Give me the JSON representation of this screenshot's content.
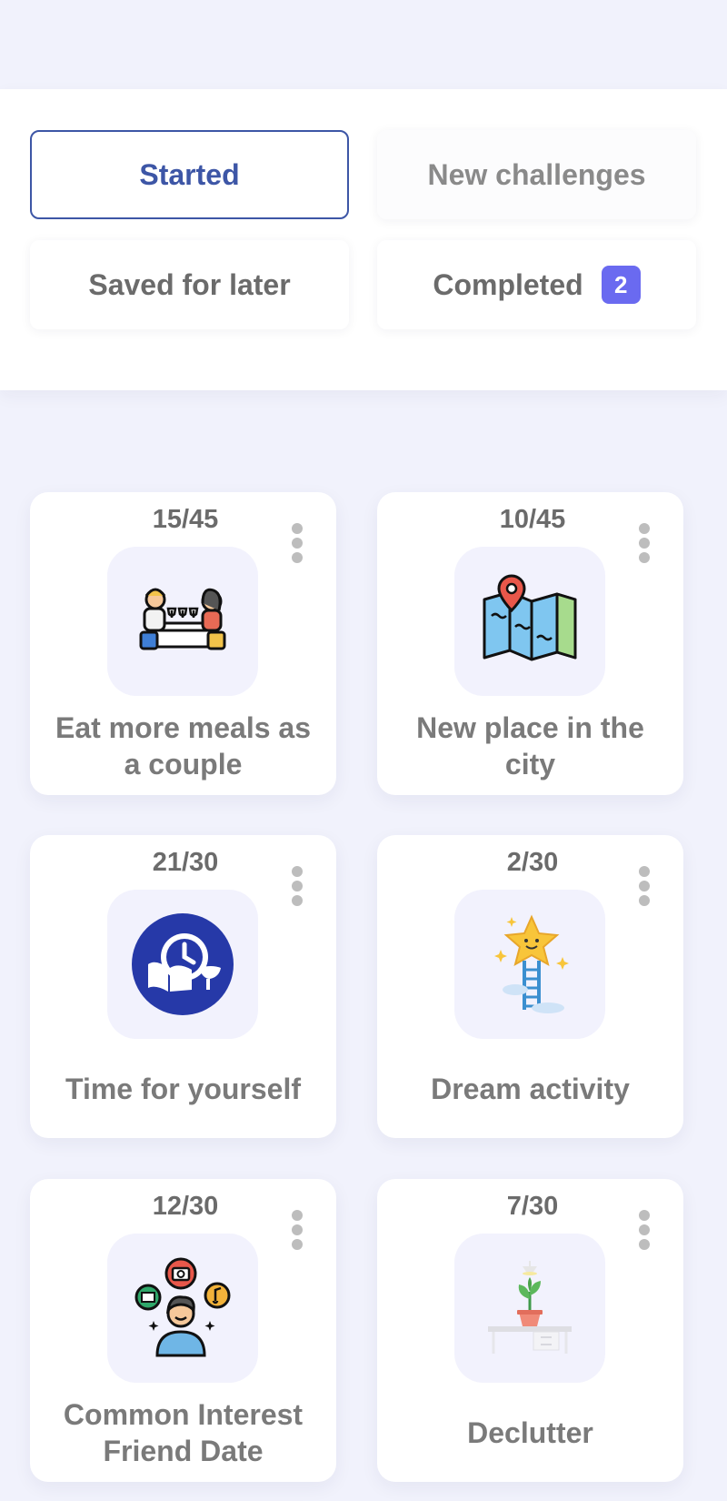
{
  "filters": {
    "started": "Started",
    "new_challenges": "New challenges",
    "saved_for_later": "Saved for later",
    "completed": "Completed",
    "completed_count": "2"
  },
  "colors": {
    "accent": "#3d56a6",
    "badge": "#6a6af0",
    "background": "#f1f2fc"
  },
  "challenges": [
    {
      "progress": "15/45",
      "title": "Eat more meals as a couple",
      "icon": "couple-dinner-icon"
    },
    {
      "progress": "10/45",
      "title": "New place in the city",
      "icon": "map-location-icon"
    },
    {
      "progress": "21/30",
      "title": "Time for yourself",
      "icon": "relax-time-icon"
    },
    {
      "progress": "2/30",
      "title": "Dream activity",
      "icon": "star-ladder-icon"
    },
    {
      "progress": "12/30",
      "title": "Common Interest Friend Date",
      "icon": "interests-person-icon"
    },
    {
      "progress": "7/30",
      "title": "Declutter",
      "icon": "plant-desk-icon"
    }
  ]
}
